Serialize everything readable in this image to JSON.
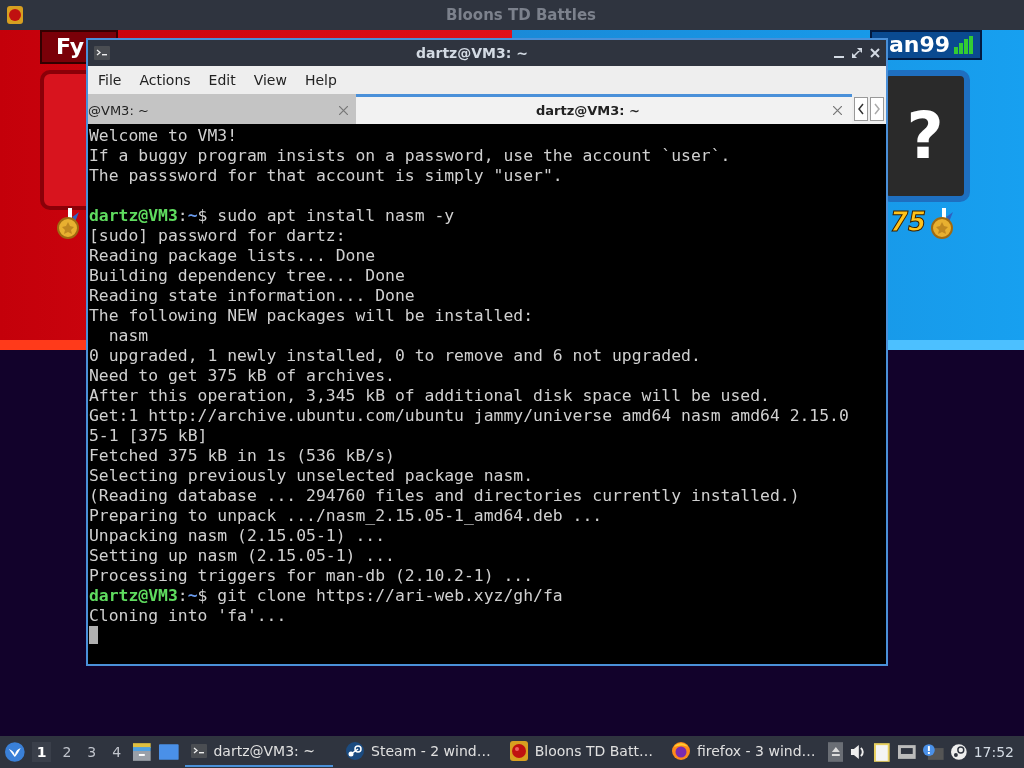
{
  "game_window": {
    "title": "Bloons TD Battles",
    "player_left": "Fy",
    "player_right": "an99",
    "medal_count": "75",
    "unknown_avatar": "?"
  },
  "terminal": {
    "title": "dartz@VM3: ~",
    "menu": [
      "File",
      "Actions",
      "Edit",
      "View",
      "Help"
    ],
    "tabs": [
      {
        "label": "@VM3: ~",
        "selected": false
      },
      {
        "label": "dartz@VM3: ~",
        "selected": true
      }
    ],
    "lines": [
      {
        "kind": "output",
        "text": "Welcome to VM3!"
      },
      {
        "kind": "output",
        "text": "If a buggy program insists on a password, use the account `user`."
      },
      {
        "kind": "output",
        "text": "The passsword for that account is simply \"user\"."
      },
      {
        "kind": "blank"
      },
      {
        "kind": "prompt",
        "user": "dartz@VM3",
        "separator": ":",
        "path": "~",
        "command": "$ sudo apt install nasm -y"
      },
      {
        "kind": "output",
        "text": "[sudo] password for dartz:"
      },
      {
        "kind": "output",
        "text": "Reading package lists... Done"
      },
      {
        "kind": "output",
        "text": "Building dependency tree... Done"
      },
      {
        "kind": "output",
        "text": "Reading state information... Done"
      },
      {
        "kind": "output",
        "text": "The following NEW packages will be installed:"
      },
      {
        "kind": "output",
        "text": "  nasm"
      },
      {
        "kind": "output",
        "text": "0 upgraded, 1 newly installed, 0 to remove and 6 not upgraded."
      },
      {
        "kind": "output",
        "text": "Need to get 375 kB of archives."
      },
      {
        "kind": "output",
        "text": "After this operation, 3,345 kB of additional disk space will be used."
      },
      {
        "kind": "output",
        "text": "Get:1 http://archive.ubuntu.com/ubuntu jammy/universe amd64 nasm amd64 2.15.0"
      },
      {
        "kind": "output",
        "text": "5-1 [375 kB]"
      },
      {
        "kind": "output",
        "text": "Fetched 375 kB in 1s (536 kB/s)"
      },
      {
        "kind": "output",
        "text": "Selecting previously unselected package nasm."
      },
      {
        "kind": "output",
        "text": "(Reading database ... 294760 files and directories currently installed.)"
      },
      {
        "kind": "output",
        "text": "Preparing to unpack .../nasm_2.15.05-1_amd64.deb ..."
      },
      {
        "kind": "output",
        "text": "Unpacking nasm (2.15.05-1) ..."
      },
      {
        "kind": "output",
        "text": "Setting up nasm (2.15.05-1) ..."
      },
      {
        "kind": "output",
        "text": "Processing triggers for man-db (2.10.2-1) ..."
      },
      {
        "kind": "prompt",
        "user": "dartz@VM3",
        "separator": ":",
        "path": "~",
        "command": "$ git clone https://ari-web.xyz/gh/fa"
      },
      {
        "kind": "output",
        "text": "Cloning into 'fa'..."
      },
      {
        "kind": "cursor"
      }
    ]
  },
  "taskbar": {
    "workspaces": [
      {
        "label": "1",
        "selected": true
      },
      {
        "label": "2",
        "selected": false
      },
      {
        "label": "3",
        "selected": false
      },
      {
        "label": "4",
        "selected": false
      }
    ],
    "tasks": [
      {
        "kind": "terminal",
        "label": "dartz@VM3: ~",
        "selected": true
      },
      {
        "kind": "steam",
        "label": "Steam - 2 wind…",
        "selected": false
      },
      {
        "kind": "game",
        "label": "Bloons TD Batt…",
        "selected": false
      },
      {
        "kind": "firefox",
        "label": "firefox - 3 wind…",
        "selected": false
      }
    ],
    "clock": "17:52"
  }
}
